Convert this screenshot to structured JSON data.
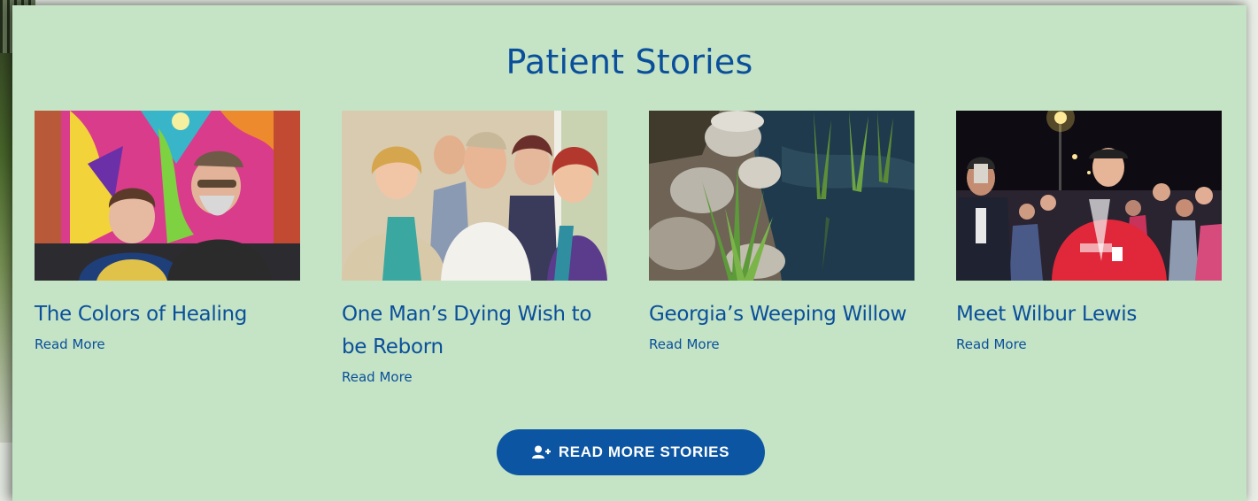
{
  "section": {
    "title": "Patient Stories"
  },
  "stories": [
    {
      "title": "The Colors of Healing",
      "link_label": "Read More",
      "image_icon": "photo-mural-couple"
    },
    {
      "title": "One Man’s Dying Wish to be Reborn",
      "link_label": "Read More",
      "image_icon": "photo-group"
    },
    {
      "title": "Georgia’s Weeping Willow",
      "link_label": "Read More",
      "image_icon": "photo-pond"
    },
    {
      "title": "Meet Wilbur Lewis",
      "link_label": "Read More",
      "image_icon": "photo-crowd-night"
    }
  ],
  "cta": {
    "label": "READ MORE STORIES",
    "icon": "add-user-icon"
  },
  "colors": {
    "panel_bg": "#c5e4c5",
    "heading": "#0a4f9b",
    "button": "#0b55a3",
    "button_text": "#ffffff"
  }
}
